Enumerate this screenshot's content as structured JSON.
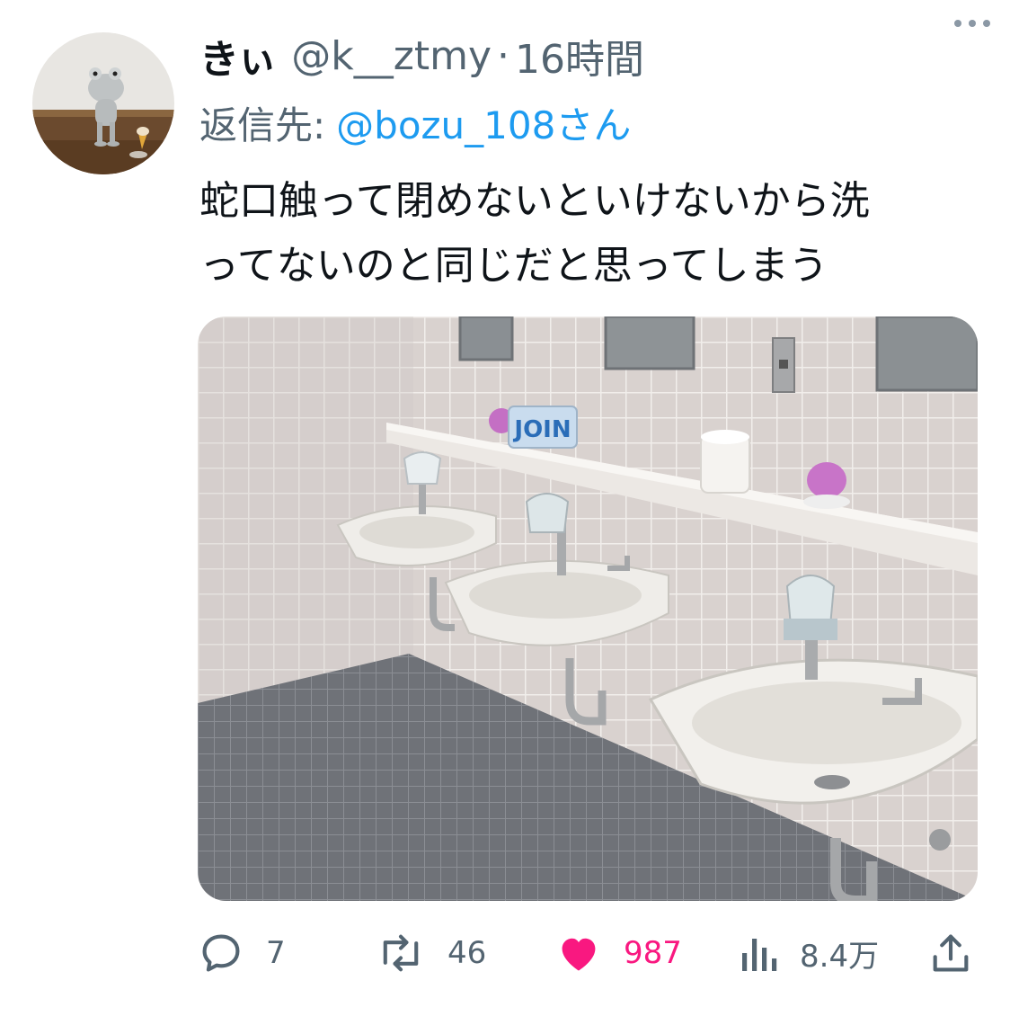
{
  "tweet": {
    "display_name": "きぃ",
    "handle": "@k__ztmy",
    "separator": "·",
    "time": "16時間",
    "reply_label": "返信先:",
    "reply_to": "@bozu_108さん",
    "text_lines": [
      "蛇口触って閉めないといけないから洗",
      "ってないのと同じだと思ってしまう"
    ]
  },
  "media": {
    "sign_text": "JOIN"
  },
  "actions": {
    "reply_count": "7",
    "retweet_count": "46",
    "like_count": "987",
    "views_count": "8.4万"
  },
  "icons": {
    "more": "more-dots-icon",
    "reply": "reply-bubble-icon",
    "retweet": "retweet-icon",
    "like": "heart-icon",
    "views": "views-bar-icon",
    "share": "share-icon"
  },
  "colors": {
    "link": "#1d9bf0",
    "like": "#f91880",
    "secondary": "#536471"
  }
}
